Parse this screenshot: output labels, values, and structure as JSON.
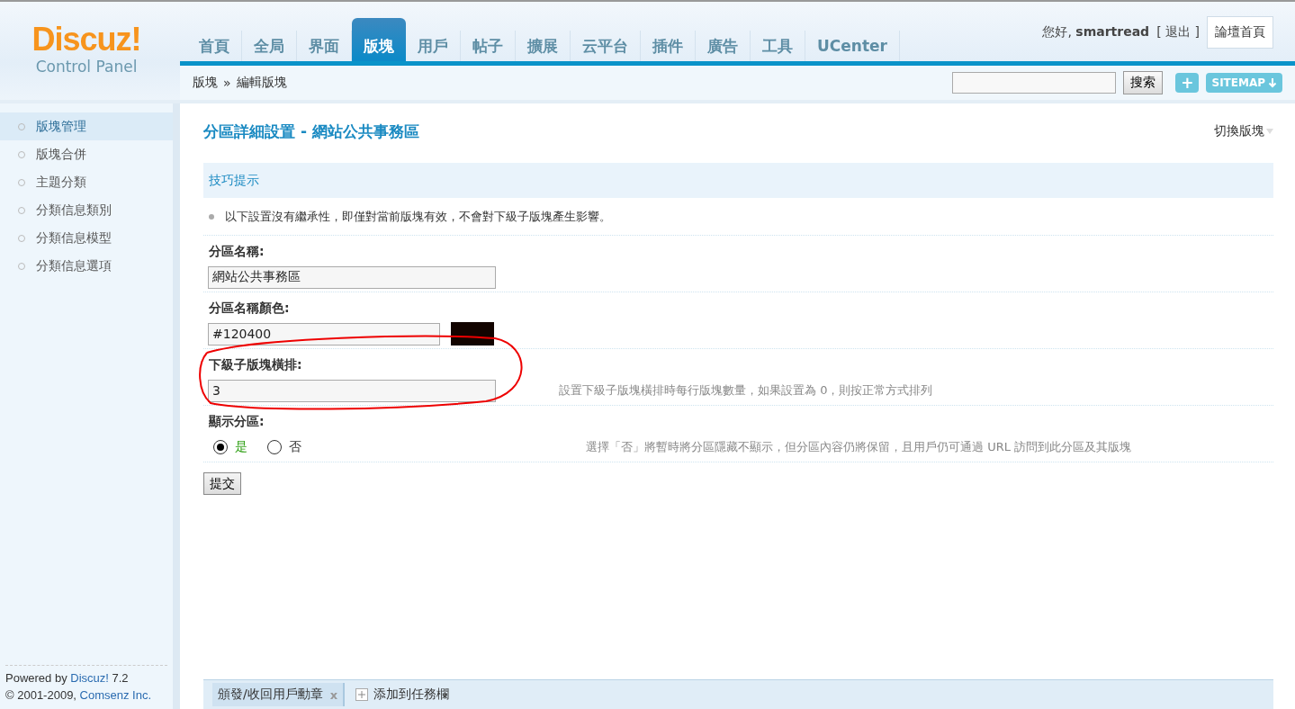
{
  "logo": {
    "title": "Discuz!",
    "subtitle": "Control Panel"
  },
  "nav": [
    {
      "label": "首頁",
      "selected": false
    },
    {
      "label": "全局",
      "selected": false
    },
    {
      "label": "界面",
      "selected": false
    },
    {
      "label": "版塊",
      "selected": true
    },
    {
      "label": "用戶",
      "selected": false
    },
    {
      "label": "帖子",
      "selected": false
    },
    {
      "label": "擴展",
      "selected": false
    },
    {
      "label": "云平台",
      "selected": false
    },
    {
      "label": "插件",
      "selected": false
    },
    {
      "label": "廣告",
      "selected": false
    },
    {
      "label": "工具",
      "selected": false
    },
    {
      "label": "UCenter",
      "selected": false
    }
  ],
  "user": {
    "greeting": "您好,",
    "name": "smartread",
    "logout_open": "[",
    "logout": "退出",
    "logout_close": "]",
    "home_button": "論壇首頁"
  },
  "breadcrumb": {
    "parent": "版塊",
    "separator": "»",
    "current": "編輯版塊"
  },
  "search": {
    "button": "搜索",
    "plus": "+",
    "sitemap": "SITEMAP"
  },
  "sidebar": [
    {
      "label": "版塊管理",
      "selected": true
    },
    {
      "label": "版塊合併",
      "selected": false
    },
    {
      "label": "主題分類",
      "selected": false
    },
    {
      "label": "分類信息類別",
      "selected": false
    },
    {
      "label": "分類信息模型",
      "selected": false
    },
    {
      "label": "分類信息選項",
      "selected": false
    }
  ],
  "credits": {
    "powered_prefix": "Powered by ",
    "powered_link": "Discuz!",
    "powered_suffix": " 7.2",
    "copy_prefix": "© 2001-2009, ",
    "copy_link": "Comsenz Inc."
  },
  "page": {
    "title": "分區詳細設置 - 網站公共事務區",
    "switch": "切換版塊"
  },
  "tips": {
    "title": "技巧提示",
    "items": [
      "以下設置沒有繼承性，即僅對當前版塊有效，不會對下級子版塊產生影響。"
    ]
  },
  "fields": [
    {
      "kind": "text",
      "label": "分區名稱:",
      "value": "網站公共事務區"
    },
    {
      "kind": "color",
      "label": "分區名稱顏色:",
      "value": "#120400"
    },
    {
      "kind": "text",
      "label": "下級子版塊橫排:",
      "value": "3",
      "hint": "設置下級子版塊橫排時每行版塊數量，如果設置為 0，則按正常方式排列",
      "annotated": true
    },
    {
      "kind": "radio",
      "label": "顯示分區:",
      "options": [
        {
          "label": "是",
          "selected": true
        },
        {
          "label": "否",
          "selected": false
        }
      ],
      "hint": "選擇「否」將暫時將分區隱藏不顯示，但分區內容仍將保留，且用戶仍可通過 URL 訪問到此分區及其版塊"
    }
  ],
  "submit": "提交",
  "taskbar": [
    {
      "kind": "tab",
      "label": "頒發/收回用戶勳章",
      "close": "x"
    },
    {
      "kind": "add",
      "label": "添加到任務欄"
    }
  ]
}
